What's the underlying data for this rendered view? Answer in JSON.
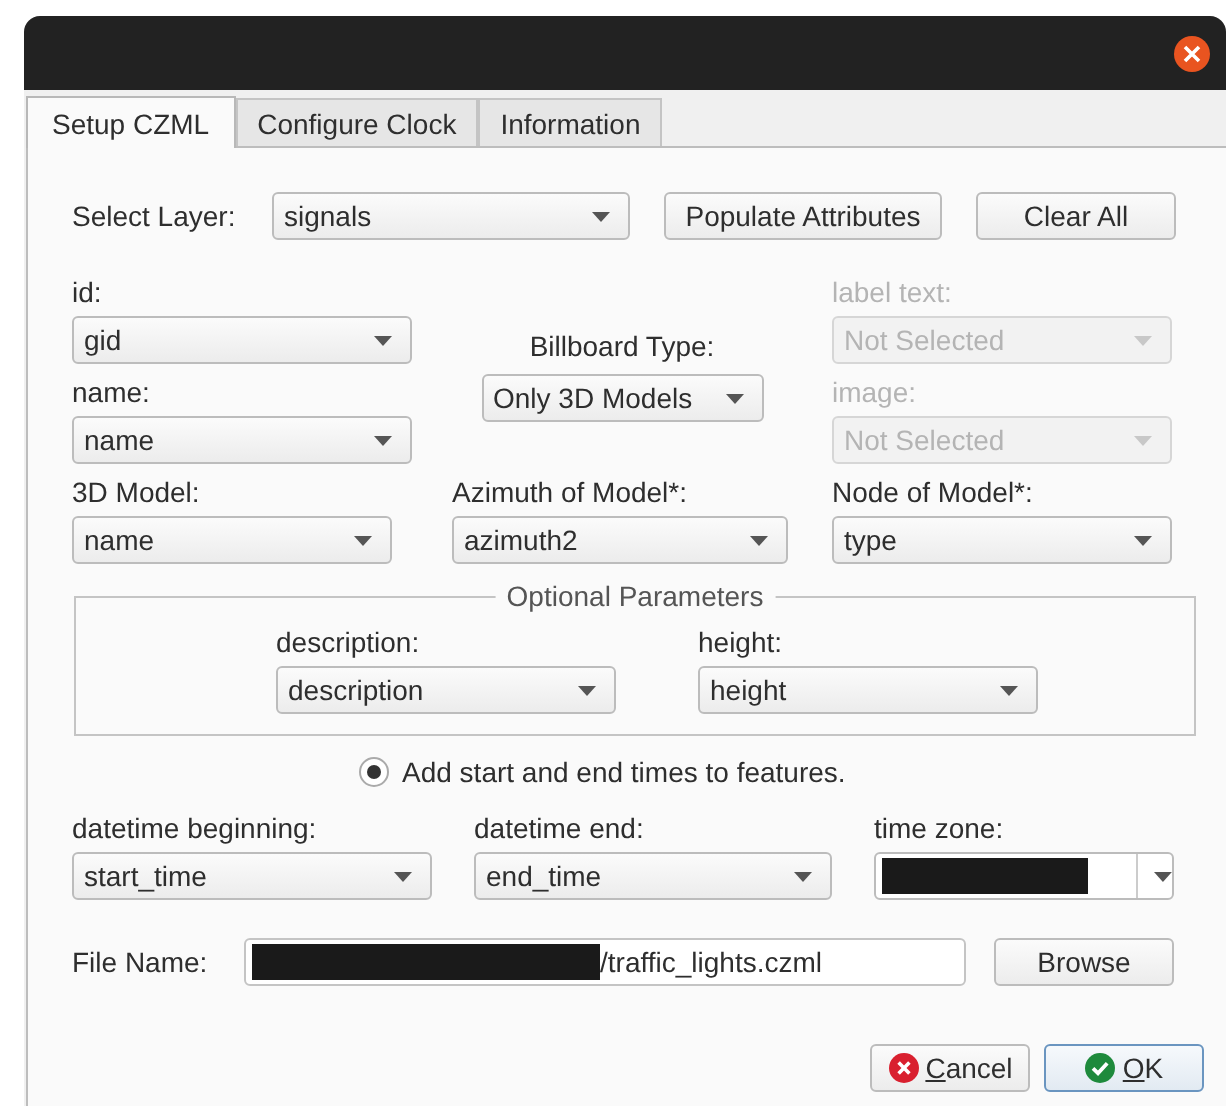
{
  "tabs": [
    {
      "label": "Setup CZML",
      "selected": true
    },
    {
      "label": "Configure Clock",
      "selected": false
    },
    {
      "label": "Information",
      "selected": false
    }
  ],
  "layer": {
    "label": "Select Layer:",
    "value": "signals"
  },
  "layer_buttons": [
    "Populate Attributes",
    "Clear All"
  ],
  "left_fields": [
    {
      "label": "id:",
      "value": "gid",
      "disabled": false
    },
    {
      "label": "name:",
      "value": "name",
      "disabled": false
    }
  ],
  "billboard": {
    "label": "Billboard Type:",
    "value": "Only 3D Models"
  },
  "right_fields": [
    {
      "label": "label text:",
      "value": "Not Selected",
      "disabled": true
    },
    {
      "label": "image:",
      "value": "Not Selected",
      "disabled": true
    }
  ],
  "model_fields": [
    {
      "label": "3D Model:",
      "value": "name",
      "disabled": false
    },
    {
      "label": "Azimuth of Model*:",
      "value": "azimuth2",
      "disabled": false
    },
    {
      "label": "Node of Model*:",
      "value": "type",
      "disabled": false
    }
  ],
  "optional": {
    "title": "Optional Parameters",
    "fields": [
      {
        "label": "description:",
        "value": "description"
      },
      {
        "label": "height:",
        "value": "height"
      }
    ]
  },
  "time_option": {
    "label": "Add start and end times to features.",
    "checked": true
  },
  "time_fields": [
    {
      "label": "datetime beginning:",
      "value": "start_time",
      "redacted": false
    },
    {
      "label": "datetime end:",
      "value": "end_time",
      "redacted": false
    },
    {
      "label": "time zone:",
      "redacted": true
    }
  ],
  "file": {
    "label": "File Name:",
    "redacted": true,
    "value": "/traffic_lights.czml",
    "button": "Browse"
  },
  "dialog_buttons": [
    {
      "kind": "cancel",
      "label": "Cancel",
      "default": false
    },
    {
      "kind": "ok",
      "label": "OK",
      "default": true
    }
  ]
}
